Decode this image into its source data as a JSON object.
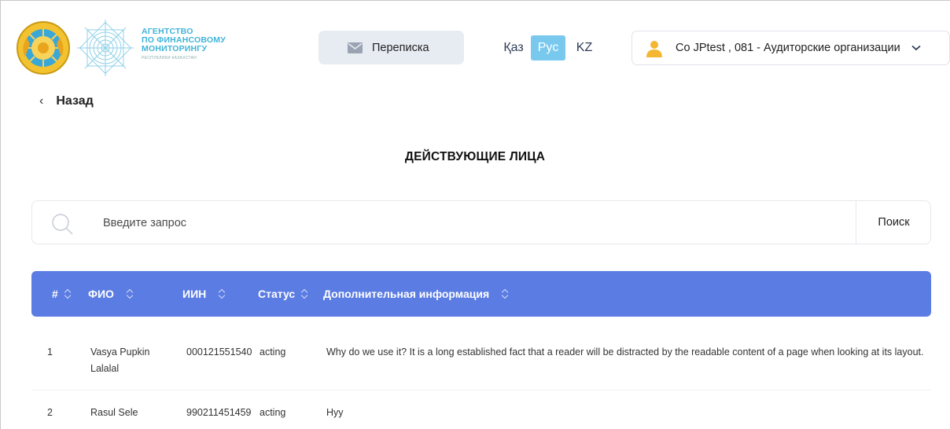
{
  "header": {
    "agency_lines": [
      "АГЕНТСТВО",
      "ПО ФИНАНСОВОМУ",
      "МОНИТОРИНГУ"
    ],
    "agency_subline": "РЕСПУБЛИКИ КАЗАХСТАН",
    "mail_label": "Переписка",
    "languages": [
      "Қаз",
      "Рус",
      "KZ"
    ],
    "active_language": "Рус",
    "user_label": "Co JPtest , 081 - Аудиторские организации"
  },
  "nav": {
    "back_label": "Назад"
  },
  "page": {
    "title": "ДЕЙСТВУЮЩИЕ ЛИЦА"
  },
  "search": {
    "placeholder": "Введите запрос",
    "value": "",
    "button_label": "Поиск"
  },
  "table": {
    "columns": [
      "#",
      "ФИО",
      "ИИН",
      "Статус",
      "Дополнительная информация"
    ],
    "rows": [
      {
        "num": "1",
        "fio": "Vasya Pupkin Lalalal",
        "iin": "000121551540",
        "status": "acting",
        "info": "Why do we use it? It is a long established fact that a reader will be distracted by the readable content of a page when looking at its layout."
      },
      {
        "num": "2",
        "fio": "Rasul Sele",
        "iin": "990211451459",
        "status": "acting",
        "info": "Hyy"
      }
    ]
  },
  "colors": {
    "table_header": "#5b7ce3",
    "active_language_bg": "#79c9ee",
    "agency_text": "#3fb4d8",
    "user_icon": "#f5b731"
  },
  "icons": {
    "emblem": "kazakhstan-emblem-icon",
    "agency": "agency-logo-icon",
    "mail": "envelope-icon",
    "user": "user-icon",
    "dropdown": "chevron-down-icon",
    "back": "chevron-left-icon",
    "search": "search-icon",
    "sort": "sort-icon"
  }
}
